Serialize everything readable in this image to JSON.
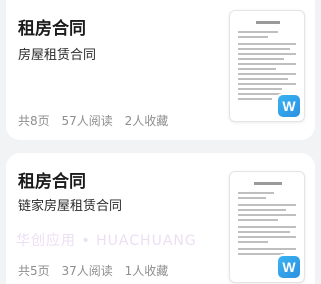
{
  "cards": [
    {
      "title": "租房合同",
      "subtitle": "房屋租赁合同",
      "pages": "共8页",
      "reads": "57人阅读",
      "favorites": "2人收藏",
      "file_type_icon": "word-icon",
      "file_type_letter": "W"
    },
    {
      "title": "租房合同",
      "subtitle": "链家房屋租赁合同",
      "pages": "共5页",
      "reads": "37人阅读",
      "favorites": "1人收藏",
      "file_type_icon": "word-icon",
      "file_type_letter": "W"
    }
  ],
  "watermark": "华创应用 • HUACHUANG",
  "colors": {
    "background": "#f2f3f5",
    "card": "#ffffff",
    "title": "#1b1b1b",
    "meta": "#8e8e8e",
    "word_icon": "#2a8fe0"
  }
}
